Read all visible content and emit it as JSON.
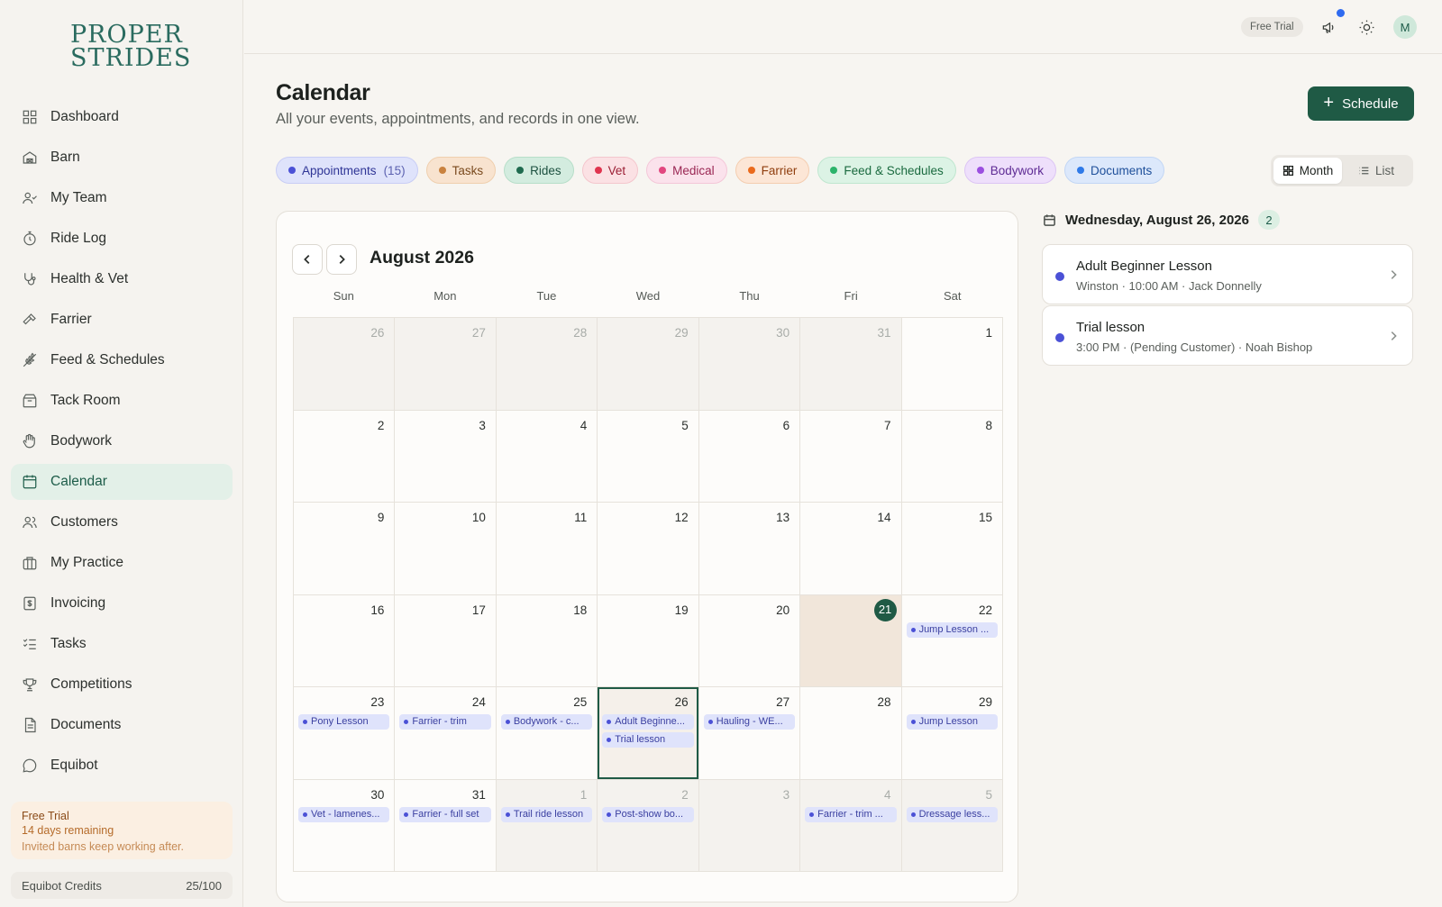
{
  "app": {
    "logo_line1": "PROPER",
    "logo_line2": "STRIDES"
  },
  "sidebar": {
    "items": [
      {
        "label": "Dashboard",
        "icon": "dashboard-icon"
      },
      {
        "label": "Barn",
        "icon": "barn-icon"
      },
      {
        "label": "My Team",
        "icon": "team-icon"
      },
      {
        "label": "Ride Log",
        "icon": "stopwatch-icon"
      },
      {
        "label": "Health & Vet",
        "icon": "stethoscope-icon"
      },
      {
        "label": "Farrier",
        "icon": "hammer-icon"
      },
      {
        "label": "Feed & Schedules",
        "icon": "wheat-icon"
      },
      {
        "label": "Tack Room",
        "icon": "package-icon"
      },
      {
        "label": "Bodywork",
        "icon": "hand-icon"
      },
      {
        "label": "Calendar",
        "icon": "calendar-icon",
        "active": true
      },
      {
        "label": "Customers",
        "icon": "users-icon"
      },
      {
        "label": "My Practice",
        "icon": "briefcase-icon"
      },
      {
        "label": "Invoicing",
        "icon": "invoice-icon"
      },
      {
        "label": "Tasks",
        "icon": "checklist-icon"
      },
      {
        "label": "Competitions",
        "icon": "trophy-icon"
      },
      {
        "label": "Documents",
        "icon": "document-icon"
      },
      {
        "label": "Equibot",
        "icon": "chat-icon"
      }
    ],
    "trial": {
      "title": "Free Trial",
      "remaining": "14 days remaining",
      "note": "Invited barns keep working after."
    },
    "credits": {
      "label": "Equibot Credits",
      "value": "25/100"
    }
  },
  "topbar": {
    "trial_badge": "Free Trial",
    "avatar_initial": "M"
  },
  "header": {
    "title": "Calendar",
    "subtitle": "All your events, appointments, and records in one view.",
    "schedule_label": "Schedule"
  },
  "filters": [
    {
      "label": "Appointments",
      "count": "(15)",
      "color": "#4b51d6",
      "bg": "#dfe3fb",
      "border": "#c8cdf5",
      "text": "#2f3596"
    },
    {
      "label": "Tasks",
      "count": "",
      "color": "#c9823f",
      "bg": "#f8e3cf",
      "border": "#efcfae",
      "text": "#7a4a1e"
    },
    {
      "label": "Rides",
      "count": "",
      "color": "#1f6b4f",
      "bg": "#d3ecdf",
      "border": "#b7dec9",
      "text": "#1d5140"
    },
    {
      "label": "Vet",
      "count": "",
      "color": "#e0344f",
      "bg": "#fbe1e4",
      "border": "#f4c6cd",
      "text": "#9c2035"
    },
    {
      "label": "Medical",
      "count": "",
      "color": "#e2467f",
      "bg": "#fbe2ec",
      "border": "#f4c7d8",
      "text": "#9a2653"
    },
    {
      "label": "Farrier",
      "count": "",
      "color": "#ea6a1c",
      "bg": "#fce6d6",
      "border": "#f4cdb0",
      "text": "#8f3e0e"
    },
    {
      "label": "Feed & Schedules",
      "count": "",
      "color": "#2bb36a",
      "bg": "#dcf3e5",
      "border": "#bfe6cf",
      "text": "#1a6a3f"
    },
    {
      "label": "Bodywork",
      "count": "",
      "color": "#9b4fe0",
      "bg": "#eedffb",
      "border": "#dcc5f4",
      "text": "#5e2b94"
    },
    {
      "label": "Documents",
      "count": "",
      "color": "#2f7ae8",
      "bg": "#dce8fb",
      "border": "#c2d6f5",
      "text": "#1e4f9a"
    }
  ],
  "view_toggle": {
    "month": "Month",
    "list": "List"
  },
  "calendar": {
    "month_title": "August 2026",
    "weekdays": [
      "Sun",
      "Mon",
      "Tue",
      "Wed",
      "Thu",
      "Fri",
      "Sat"
    ],
    "days": [
      {
        "n": "26",
        "other": true,
        "events": []
      },
      {
        "n": "27",
        "other": true,
        "events": []
      },
      {
        "n": "28",
        "other": true,
        "events": []
      },
      {
        "n": "29",
        "other": true,
        "events": []
      },
      {
        "n": "30",
        "other": true,
        "events": []
      },
      {
        "n": "31",
        "other": true,
        "events": []
      },
      {
        "n": "1",
        "events": []
      },
      {
        "n": "2",
        "events": []
      },
      {
        "n": "3",
        "events": []
      },
      {
        "n": "4",
        "events": []
      },
      {
        "n": "5",
        "events": []
      },
      {
        "n": "6",
        "events": []
      },
      {
        "n": "7",
        "events": []
      },
      {
        "n": "8",
        "events": []
      },
      {
        "n": "9",
        "events": []
      },
      {
        "n": "10",
        "events": []
      },
      {
        "n": "11",
        "events": []
      },
      {
        "n": "12",
        "events": []
      },
      {
        "n": "13",
        "events": []
      },
      {
        "n": "14",
        "events": []
      },
      {
        "n": "15",
        "events": []
      },
      {
        "n": "16",
        "events": []
      },
      {
        "n": "17",
        "events": []
      },
      {
        "n": "18",
        "events": []
      },
      {
        "n": "19",
        "events": []
      },
      {
        "n": "20",
        "events": []
      },
      {
        "n": "21",
        "today": true,
        "events": []
      },
      {
        "n": "22",
        "events": [
          "Jump Lesson ..."
        ]
      },
      {
        "n": "23",
        "events": [
          "Pony Lesson"
        ]
      },
      {
        "n": "24",
        "events": [
          "Farrier - trim"
        ]
      },
      {
        "n": "25",
        "events": [
          "Bodywork - c..."
        ]
      },
      {
        "n": "26",
        "selected": true,
        "events": [
          "Adult Beginne...",
          "Trial lesson"
        ]
      },
      {
        "n": "27",
        "events": [
          "Hauling - WE..."
        ]
      },
      {
        "n": "28",
        "events": []
      },
      {
        "n": "29",
        "events": [
          "Jump Lesson"
        ]
      },
      {
        "n": "30",
        "events": [
          "Vet - lamenes..."
        ]
      },
      {
        "n": "31",
        "events": [
          "Farrier - full set"
        ]
      },
      {
        "n": "1",
        "other": true,
        "events": [
          "Trail ride lesson"
        ]
      },
      {
        "n": "2",
        "other": true,
        "events": [
          "Post-show bo..."
        ]
      },
      {
        "n": "3",
        "other": true,
        "events": []
      },
      {
        "n": "4",
        "other": true,
        "events": [
          "Farrier - trim ..."
        ]
      },
      {
        "n": "5",
        "other": true,
        "events": [
          "Dressage less..."
        ]
      }
    ]
  },
  "day_panel": {
    "date": "Wednesday, August 26, 2026",
    "count": "2",
    "appointments": [
      {
        "title": "Adult Beginner Lesson",
        "meta": "Winston  ·  10:00 AM · Jack Donnelly"
      },
      {
        "title": "Trial lesson",
        "meta": "3:00 PM · (Pending Customer) · Noah Bishop"
      }
    ]
  }
}
